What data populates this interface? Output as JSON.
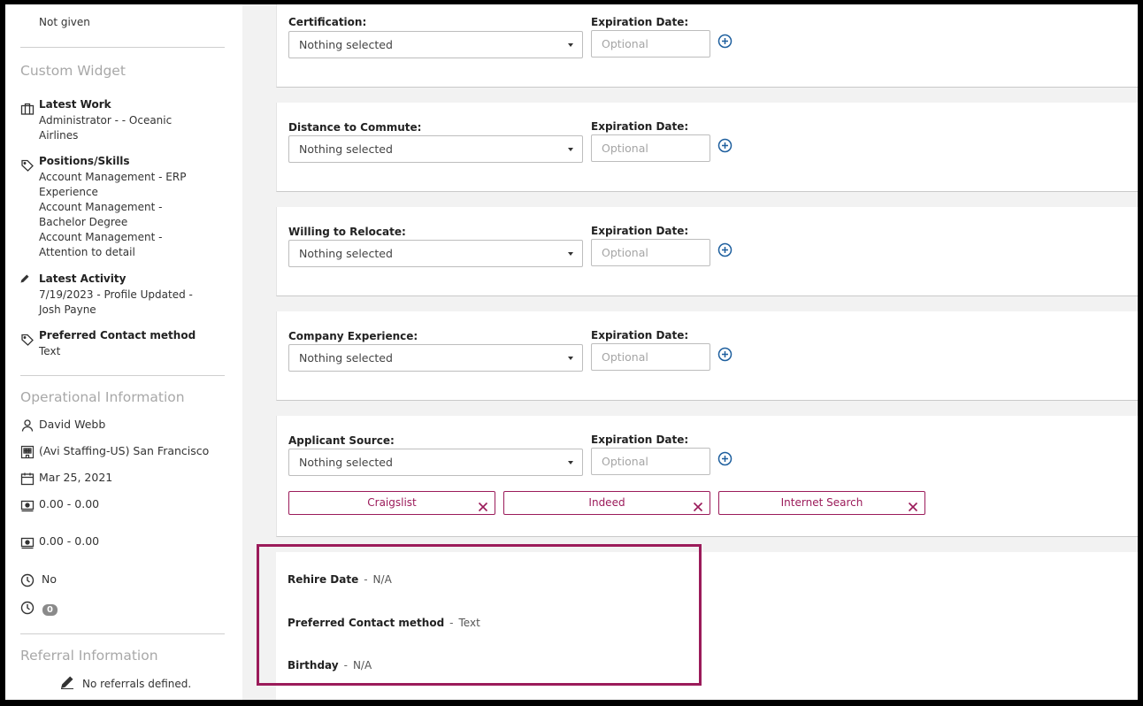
{
  "sidebar": {
    "email_consent_value": "Not given",
    "custom_widget_title": "Custom Widget",
    "latest_work": {
      "label": "Latest Work",
      "lines": [
        "Administrator - - Oceanic",
        "Airlines"
      ]
    },
    "positions_skills": {
      "label": "Positions/Skills",
      "lines": [
        "Account Management - ERP",
        "Experience",
        "Account Management -",
        "Bachelor Degree",
        "Account Management -",
        "Attention to detail"
      ]
    },
    "latest_activity": {
      "label": "Latest Activity",
      "lines": [
        "7/19/2023 - Profile Updated -",
        "Josh Payne"
      ]
    },
    "preferred_contact": {
      "label": "Preferred Contact method",
      "value": "Text"
    },
    "operational_title": "Operational Information",
    "owner": "David Webb",
    "branch": "(Avi Staffing-US) San Francisco",
    "date": "Mar 25, 2021",
    "pay_range_1": "0.00 - 0.00",
    "pay_range_2": "0.00 - 0.00",
    "clock_value": "No",
    "clock_badge": "0",
    "referral_title": "Referral Information",
    "no_referrals": "No referrals defined."
  },
  "fields": [
    {
      "label": "Certification:",
      "select_value": "Nothing selected",
      "date_label": "Expiration Date:",
      "date_placeholder": "Optional"
    },
    {
      "label": "Distance to Commute:",
      "select_value": "Nothing selected",
      "date_label": "Expiration Date:",
      "date_placeholder": "Optional"
    },
    {
      "label": "Willing to Relocate:",
      "select_value": "Nothing selected",
      "date_label": "Expiration Date:",
      "date_placeholder": "Optional"
    },
    {
      "label": "Company Experience:",
      "select_value": "Nothing selected",
      "date_label": "Expiration Date:",
      "date_placeholder": "Optional"
    },
    {
      "label": "Applicant Source:",
      "select_value": "Nothing selected",
      "date_label": "Expiration Date:",
      "date_placeholder": "Optional"
    }
  ],
  "applicant_source_tags": [
    "Craigslist",
    "Indeed",
    "Internet Search"
  ],
  "details": {
    "rehire_date": {
      "label": "Rehire Date",
      "sep": "-",
      "value": "N/A"
    },
    "preferred_contact": {
      "label": "Preferred Contact method",
      "sep": "-",
      "value": "Text"
    },
    "birthday": {
      "label": "Birthday",
      "sep": "-",
      "value": "N/A"
    }
  },
  "colors": {
    "accent": "#9b1b5a",
    "plus_icon": "#1e5f9e",
    "section_title": "#a8a8a8",
    "panel_bg": "#f2f2f2"
  },
  "icons": [
    "briefcase-icon",
    "tag-icon",
    "pencil-icon",
    "person-icon",
    "building-icon",
    "calendar-icon",
    "money-icon",
    "clock-icon",
    "plus-circle-icon",
    "remove-x-icon"
  ]
}
